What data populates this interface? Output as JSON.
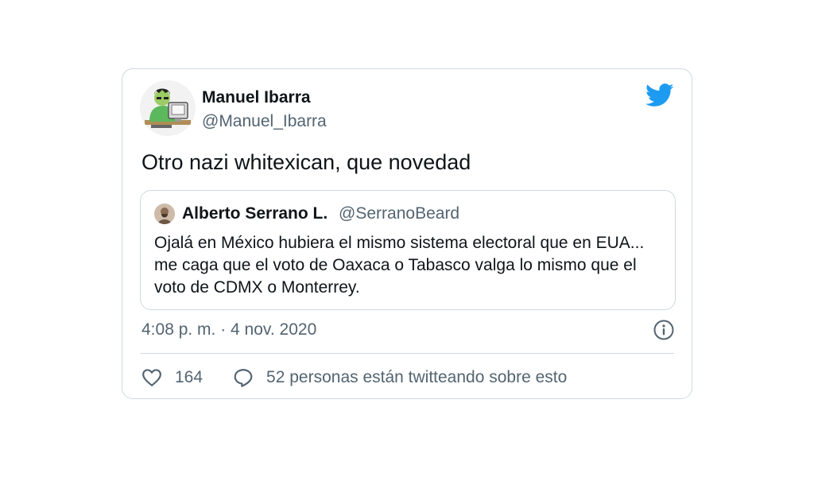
{
  "tweet": {
    "author_name": "Manuel Ibarra",
    "author_handle": "@Manuel_Ibarra",
    "text": "Otro nazi whitexican, que novedad",
    "timestamp": "4:08 p. m. · 4 nov. 2020",
    "likes": "164",
    "conversation": "52 personas están twitteando sobre esto"
  },
  "quoted_tweet": {
    "author_name": "Alberto Serrano L.",
    "author_handle": "@SerranoBeard",
    "text": "Ojalá en México hubiera el mismo sistema electoral que en EUA... me caga que el voto de Oaxaca o Tabasco valga lo mismo que el voto de CDMX o Monterrey."
  },
  "icons": {
    "brand": "twitter-bird-icon",
    "info": "info-icon",
    "like": "heart-icon",
    "reply": "reply-icon"
  },
  "colors": {
    "brand": "#1d9bf0",
    "primary_text": "#0f1419",
    "secondary_text": "#536471",
    "border": "#cfd9de"
  }
}
